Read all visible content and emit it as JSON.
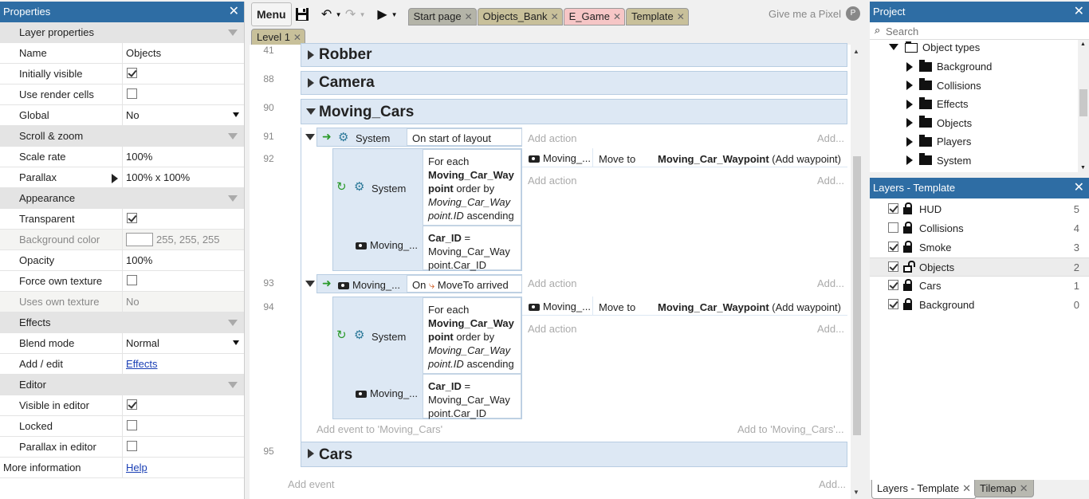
{
  "properties": {
    "title": "Properties",
    "sections": [
      {
        "label": "Layer properties",
        "rows": [
          {
            "name": "Name",
            "value": "Objects"
          },
          {
            "name": "Initially visible",
            "check": true
          },
          {
            "name": "Use render cells",
            "check": false
          },
          {
            "name": "Global",
            "value": "No",
            "dropdown": true
          }
        ]
      },
      {
        "label": "Scroll & zoom",
        "rows": [
          {
            "name": "Scale rate",
            "value": "100%"
          },
          {
            "name": "Parallax",
            "value": "100% x 100%",
            "expand": true
          }
        ]
      },
      {
        "label": "Appearance",
        "rows": [
          {
            "name": "Transparent",
            "check": true
          },
          {
            "name": "Background color",
            "value": "255, 255, 255",
            "swatch": true,
            "disabled": true
          },
          {
            "name": "Opacity",
            "value": "100%"
          },
          {
            "name": "Force own texture",
            "check": false
          },
          {
            "name": "Uses own texture",
            "value": "No",
            "disabled": true
          }
        ]
      },
      {
        "label": "Effects",
        "rows": [
          {
            "name": "Blend mode",
            "value": "Normal",
            "dropdown": true
          },
          {
            "name": "Add / edit",
            "link": "Effects"
          }
        ]
      },
      {
        "label": "Editor",
        "rows": [
          {
            "name": "Visible in editor",
            "check": true
          },
          {
            "name": "Locked",
            "check": false
          },
          {
            "name": "Parallax in editor",
            "check": false
          }
        ]
      }
    ],
    "more_info_label": "More information",
    "more_info_link": "Help"
  },
  "toolbar": {
    "menu": "Menu",
    "tabs": [
      {
        "label": "Start page",
        "bg": "#b4b4a8"
      },
      {
        "label": "Objects_Bank",
        "bg": "#c8c09a"
      },
      {
        "label": "E_Game",
        "bg": "#f6c6c6"
      },
      {
        "label": "Template",
        "bg": "#c8c09a"
      }
    ],
    "user": "Give me a Pixel",
    "user_initial": "P",
    "subtab": "Level 1"
  },
  "events": {
    "groups": [
      {
        "line": "41",
        "name": "Robber"
      },
      {
        "line": "88",
        "name": "Camera"
      },
      {
        "line": "90",
        "name": "Moving_Cars"
      },
      {
        "line": "95",
        "name": "Cars"
      }
    ],
    "ev91": {
      "line": "91",
      "obj": "System",
      "cond": "On start of layout",
      "add_action": "Add action",
      "add": "Add..."
    },
    "ev92": {
      "line": "92",
      "obj": "System",
      "foreach_pre": "For each",
      "foreach_obj": "Moving_Car_Waypoint",
      "foreach_mid": "order by",
      "foreach_expr": "Moving_Car_Waypoint.ID",
      "foreach_post": "ascending",
      "cond2_obj": "Moving_...",
      "cond2_var": "Car_ID",
      "cond2_eq": "=",
      "cond2_expr": "Moving_Car_Waypoint.Car_ID",
      "act_obj": "Moving_...",
      "act_verb": "Move to",
      "act_target": "Moving_Car_Waypoint",
      "act_suffix": "(Add waypoint)",
      "add_action": "Add action",
      "add": "Add..."
    },
    "ev93": {
      "line": "93",
      "obj": "Moving_...",
      "cond_pre": "On",
      "cond": "MoveTo arrived",
      "add_action": "Add action",
      "add": "Add..."
    },
    "ev94": {
      "line": "94",
      "obj": "System",
      "foreach_pre": "For each",
      "foreach_obj": "Moving_Car_Waypoint",
      "foreach_mid": "order by",
      "foreach_expr": "Moving_Car_Waypoint.ID",
      "foreach_post": "ascending",
      "cond2_obj": "Moving_...",
      "cond2_var": "Car_ID",
      "cond2_eq": "=",
      "cond2_expr": "Moving_Car_Waypoint.Car_ID",
      "act_obj": "Moving_...",
      "act_verb": "Move to",
      "act_target": "Moving_Car_Waypoint",
      "act_suffix": "(Add waypoint)",
      "add_action": "Add action",
      "add": "Add..."
    },
    "add_event_group": "Add event to 'Moving_Cars'",
    "add_to_group": "Add to 'Moving_Cars'...",
    "add_event": "Add event",
    "add": "Add..."
  },
  "project": {
    "title": "Project",
    "search_placeholder": "Search",
    "root": "Object types",
    "folders": [
      "Background",
      "Collisions",
      "Effects",
      "Objects",
      "Players",
      "System"
    ]
  },
  "layers": {
    "title": "Layers - Template",
    "items": [
      {
        "name": "HUD",
        "num": "5",
        "visible": true,
        "locked": true
      },
      {
        "name": "Collisions",
        "num": "4",
        "visible": false,
        "locked": true
      },
      {
        "name": "Smoke",
        "num": "3",
        "visible": true,
        "locked": true
      },
      {
        "name": "Objects",
        "num": "2",
        "visible": true,
        "locked": false,
        "selected": true
      },
      {
        "name": "Cars",
        "num": "1",
        "visible": true,
        "locked": true
      },
      {
        "name": "Background",
        "num": "0",
        "visible": true,
        "locked": true
      }
    ],
    "tabs": [
      "Layers - Template",
      "Tilemap"
    ]
  }
}
